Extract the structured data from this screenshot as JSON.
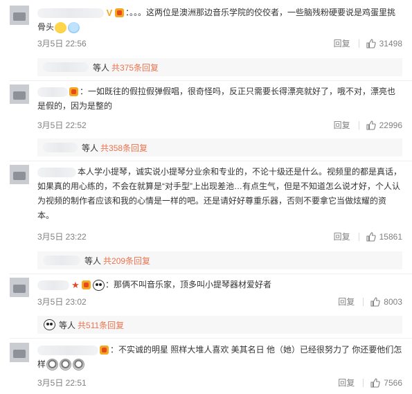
{
  "comments": [
    {
      "text": "：。。。这两位是澳洲那边音乐学院的佼佼者，一些脑残粉硬要说是鸡蛋里挑骨头",
      "time": "3月5日 22:56",
      "reply_label": "回复",
      "likes": "31498",
      "sub": {
        "label": "等人",
        "count_text": "共375条回复"
      }
    },
    {
      "text": "：一如既往的假拉假弹假唱，很奇怪吗，反正只需要长得漂亮就好了，哦不对，漂亮也是假的，因为是整的",
      "time": "3月5日 22:52",
      "reply_label": "回复",
      "likes": "22996",
      "sub": {
        "label": "等人",
        "count_text": "共358条回复"
      }
    },
    {
      "text": "本人学小提琴，诚实说小提琴分业余和专业的，不论十级还是什么。视频里的都是真话，如果真的用心练的，不会在就算是“对手型”上出现差池…有点生气，但是不知道怎么说才好，个人认为视频的制作者应该和我的心情是一样的吧。还是请好好尊重乐器，否则不要拿它当做炫耀的资本。",
      "time": "3月5日 23:22",
      "reply_label": "回复",
      "likes": "15861",
      "sub": {
        "label": "等人",
        "count_text": "共209条回复"
      }
    },
    {
      "text": "：那俩不叫音乐家，顶多叫小提琴器材爱好者",
      "time": "3月5日 23:02",
      "reply_label": "回复",
      "likes": "8003",
      "sub": {
        "label": "等人",
        "count_text": "共511条回复"
      }
    },
    {
      "text": "：不实诚的明星 照样大堆人喜欢 美其名日 他（她）已经很努力了 你还要他们怎样",
      "time": "3月5日 22:51",
      "reply_label": "回复",
      "likes": "7566"
    }
  ],
  "colors": {
    "accent": "#eb7350",
    "meta": "#808080",
    "text": "#333333",
    "subbg": "#f7f7f7"
  },
  "icons": [
    "thumbs-up-icon",
    "vip-badge-icon",
    "verified-v-icon",
    "star-badge-icon",
    "panda-emoji-icon",
    "cry-emoji-icon"
  ]
}
